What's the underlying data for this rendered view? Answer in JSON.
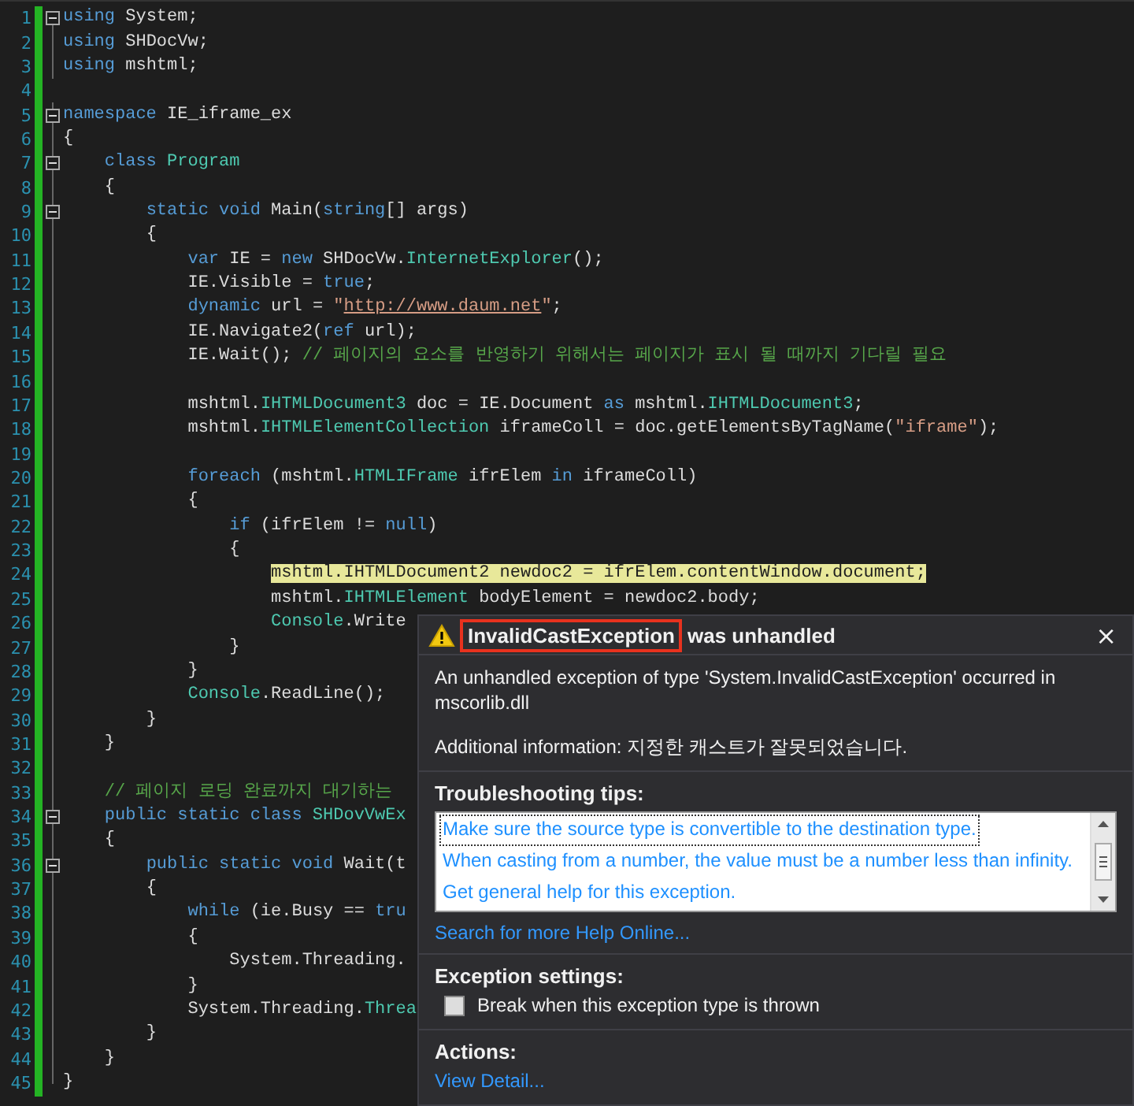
{
  "editor": {
    "lines": [
      {
        "number": "1",
        "fold": true,
        "highlighted": false,
        "tokens": [
          {
            "kind": "keyword",
            "text": "using"
          },
          {
            "kind": "plain",
            "text": " System;"
          }
        ]
      },
      {
        "number": "2",
        "fold": false,
        "highlighted": false,
        "tokens": [
          {
            "kind": "keyword",
            "text": "using"
          },
          {
            "kind": "plain",
            "text": " SHDocVw;"
          }
        ]
      },
      {
        "number": "3",
        "fold": false,
        "highlighted": false,
        "tokens": [
          {
            "kind": "keyword",
            "text": "using"
          },
          {
            "kind": "plain",
            "text": " mshtml;"
          }
        ]
      },
      {
        "number": "4",
        "fold": false,
        "highlighted": false
      },
      {
        "number": "5",
        "fold": true,
        "highlighted": false,
        "tokens": [
          {
            "kind": "keyword",
            "text": "namespace"
          },
          {
            "kind": "plain",
            "text": " IE_iframe_ex"
          }
        ]
      },
      {
        "number": "6",
        "fold": false,
        "highlighted": false,
        "tokens": [
          {
            "kind": "plain",
            "text": "{"
          }
        ]
      },
      {
        "number": "7",
        "fold": true,
        "highlighted": false,
        "tokens": [
          {
            "kind": "keyword",
            "text": "    class"
          },
          {
            "kind": "type",
            "text": " Program"
          }
        ]
      },
      {
        "number": "8",
        "fold": false,
        "highlighted": false,
        "tokens": [
          {
            "kind": "plain",
            "text": "    {"
          }
        ]
      },
      {
        "number": "9",
        "fold": true,
        "highlighted": false,
        "tokens": [
          {
            "kind": "keyword",
            "text": "        static"
          },
          {
            "kind": "keyword",
            "text": " void"
          },
          {
            "kind": "plain",
            "text": " Main("
          },
          {
            "kind": "keyword",
            "text": "string"
          },
          {
            "kind": "plain",
            "text": "[] args)"
          }
        ]
      },
      {
        "number": "10",
        "fold": false,
        "highlighted": false,
        "tokens": [
          {
            "kind": "plain",
            "text": "        {"
          }
        ]
      },
      {
        "number": "11",
        "fold": false,
        "highlighted": false,
        "tokens": [
          {
            "kind": "keyword",
            "text": "            var"
          },
          {
            "kind": "plain",
            "text": " IE = "
          },
          {
            "kind": "keyword",
            "text": "new"
          },
          {
            "kind": "plain",
            "text": " SHDocVw."
          },
          {
            "kind": "type",
            "text": "InternetExplorer"
          },
          {
            "kind": "plain",
            "text": "();"
          }
        ]
      },
      {
        "number": "12",
        "fold": false,
        "highlighted": false,
        "tokens": [
          {
            "kind": "plain",
            "text": "            IE.Visible = "
          },
          {
            "kind": "keyword",
            "text": "true"
          },
          {
            "kind": "plain",
            "text": ";"
          }
        ]
      },
      {
        "number": "13",
        "fold": false,
        "highlighted": false,
        "tokens": [
          {
            "kind": "keyword",
            "text": "            dynamic"
          },
          {
            "kind": "plain",
            "text": " url = "
          },
          {
            "kind": "string",
            "text": "\""
          },
          {
            "kind": "url",
            "text": "http://www.daum.net"
          },
          {
            "kind": "string",
            "text": "\""
          },
          {
            "kind": "plain",
            "text": ";"
          }
        ]
      },
      {
        "number": "14",
        "fold": false,
        "highlighted": false,
        "tokens": [
          {
            "kind": "plain",
            "text": "            IE.Navigate2("
          },
          {
            "kind": "keyword",
            "text": "ref"
          },
          {
            "kind": "plain",
            "text": " url);"
          }
        ]
      },
      {
        "number": "15",
        "fold": false,
        "highlighted": false,
        "tokens": [
          {
            "kind": "plain",
            "text": "            IE.Wait(); "
          },
          {
            "kind": "comment",
            "text": "// 페이지의 요소를 반영하기 위해서는 페이지가 표시 될 때까지 기다릴 필요"
          }
        ]
      },
      {
        "number": "16",
        "fold": false,
        "highlighted": false
      },
      {
        "number": "17",
        "fold": false,
        "highlighted": false,
        "tokens": [
          {
            "kind": "plain",
            "text": "            mshtml."
          },
          {
            "kind": "type",
            "text": "IHTMLDocument3"
          },
          {
            "kind": "plain",
            "text": " doc = IE.Document "
          },
          {
            "kind": "keyword",
            "text": "as"
          },
          {
            "kind": "plain",
            "text": " mshtml."
          },
          {
            "kind": "type",
            "text": "IHTMLDocument3"
          },
          {
            "kind": "plain",
            "text": ";"
          }
        ]
      },
      {
        "number": "18",
        "fold": false,
        "highlighted": false,
        "tokens": [
          {
            "kind": "plain",
            "text": "            mshtml."
          },
          {
            "kind": "type",
            "text": "IHTMLElementCollection"
          },
          {
            "kind": "plain",
            "text": " iframeColl = doc.getElementsByTagName("
          },
          {
            "kind": "string",
            "text": "\"iframe\""
          },
          {
            "kind": "plain",
            "text": ");"
          }
        ]
      },
      {
        "number": "19",
        "fold": false,
        "highlighted": false
      },
      {
        "number": "20",
        "fold": false,
        "highlighted": false,
        "tokens": [
          {
            "kind": "keyword",
            "text": "            foreach"
          },
          {
            "kind": "plain",
            "text": " (mshtml."
          },
          {
            "kind": "type",
            "text": "HTMLIFrame"
          },
          {
            "kind": "plain",
            "text": " ifrElem "
          },
          {
            "kind": "keyword",
            "text": "in"
          },
          {
            "kind": "plain",
            "text": " iframeColl)"
          }
        ]
      },
      {
        "number": "21",
        "fold": false,
        "highlighted": false,
        "tokens": [
          {
            "kind": "plain",
            "text": "            {"
          }
        ]
      },
      {
        "number": "22",
        "fold": false,
        "highlighted": false,
        "tokens": [
          {
            "kind": "keyword",
            "text": "                if"
          },
          {
            "kind": "plain",
            "text": " (ifrElem != "
          },
          {
            "kind": "keyword",
            "text": "null"
          },
          {
            "kind": "plain",
            "text": ")"
          }
        ]
      },
      {
        "number": "23",
        "fold": false,
        "highlighted": false,
        "tokens": [
          {
            "kind": "plain",
            "text": "                {"
          }
        ]
      },
      {
        "number": "24",
        "fold": false,
        "highlighted": true,
        "tokens": [
          {
            "kind": "plain",
            "text": "                    mshtml."
          },
          {
            "kind": "type",
            "text": "IHTMLDocument2"
          },
          {
            "kind": "plain",
            "text": " newdoc2 = ifrElem.contentWindow.document;"
          }
        ]
      },
      {
        "number": "25",
        "fold": false,
        "highlighted": false,
        "tokens": [
          {
            "kind": "plain",
            "text": "                    mshtml."
          },
          {
            "kind": "type",
            "text": "IHTMLElement"
          },
          {
            "kind": "plain",
            "text": " bodyElement = newdoc2.body;"
          }
        ]
      },
      {
        "number": "26",
        "fold": false,
        "highlighted": false,
        "tokens": [
          {
            "kind": "type",
            "text": "                    Console"
          },
          {
            "kind": "plain",
            "text": ".Write"
          }
        ]
      },
      {
        "number": "27",
        "fold": false,
        "highlighted": false,
        "tokens": [
          {
            "kind": "plain",
            "text": "                }"
          }
        ]
      },
      {
        "number": "28",
        "fold": false,
        "highlighted": false,
        "tokens": [
          {
            "kind": "plain",
            "text": "            }"
          }
        ]
      },
      {
        "number": "29",
        "fold": false,
        "highlighted": false,
        "tokens": [
          {
            "kind": "type",
            "text": "            Console"
          },
          {
            "kind": "plain",
            "text": ".ReadLine();"
          }
        ]
      },
      {
        "number": "30",
        "fold": false,
        "highlighted": false,
        "tokens": [
          {
            "kind": "plain",
            "text": "        }"
          }
        ]
      },
      {
        "number": "31",
        "fold": false,
        "highlighted": false,
        "tokens": [
          {
            "kind": "plain",
            "text": "    }"
          }
        ]
      },
      {
        "number": "32",
        "fold": false,
        "highlighted": false
      },
      {
        "number": "33",
        "fold": false,
        "highlighted": false,
        "tokens": [
          {
            "kind": "comment",
            "text": "    // 페이지 로딩 완료까지 대기하는"
          }
        ]
      },
      {
        "number": "34",
        "fold": true,
        "highlighted": false,
        "tokens": [
          {
            "kind": "keyword",
            "text": "    public static class"
          },
          {
            "kind": "type",
            "text": " SHDovVwEx"
          }
        ]
      },
      {
        "number": "35",
        "fold": false,
        "highlighted": false,
        "tokens": [
          {
            "kind": "plain",
            "text": "    {"
          }
        ]
      },
      {
        "number": "36",
        "fold": true,
        "highlighted": false,
        "tokens": [
          {
            "kind": "keyword",
            "text": "        public static void"
          },
          {
            "kind": "plain",
            "text": " Wait(t"
          }
        ]
      },
      {
        "number": "37",
        "fold": false,
        "highlighted": false,
        "tokens": [
          {
            "kind": "plain",
            "text": "        {"
          }
        ]
      },
      {
        "number": "38",
        "fold": false,
        "highlighted": false,
        "tokens": [
          {
            "kind": "keyword",
            "text": "            while"
          },
          {
            "kind": "plain",
            "text": " (ie.Busy == "
          },
          {
            "kind": "keyword",
            "text": "tru"
          }
        ]
      },
      {
        "number": "39",
        "fold": false,
        "highlighted": false,
        "tokens": [
          {
            "kind": "plain",
            "text": "            {"
          }
        ]
      },
      {
        "number": "40",
        "fold": false,
        "highlighted": false,
        "tokens": [
          {
            "kind": "plain",
            "text": "                System.Threading."
          }
        ]
      },
      {
        "number": "41",
        "fold": false,
        "highlighted": false,
        "tokens": [
          {
            "kind": "plain",
            "text": "            }"
          }
        ]
      },
      {
        "number": "42",
        "fold": false,
        "highlighted": false,
        "tokens": [
          {
            "kind": "plain",
            "text": "            System.Threading."
          },
          {
            "kind": "type",
            "text": "Threa"
          }
        ]
      },
      {
        "number": "43",
        "fold": false,
        "highlighted": false,
        "tokens": [
          {
            "kind": "plain",
            "text": "        }"
          }
        ]
      },
      {
        "number": "44",
        "fold": false,
        "highlighted": false,
        "tokens": [
          {
            "kind": "plain",
            "text": "    }"
          }
        ]
      },
      {
        "number": "45",
        "fold": false,
        "highlighted": false,
        "tokens": [
          {
            "kind": "plain",
            "text": "}"
          }
        ]
      }
    ]
  },
  "exception_dialog": {
    "exception_name": "InvalidCastException",
    "title_rest": "was unhandled",
    "close": "×",
    "message": "An unhandled exception of type 'System.InvalidCastException' occurred in mscorlib.dll",
    "additional_info": "Additional information: 지정한 캐스트가 잘못되었습니다.",
    "tips_heading": "Troubleshooting tips:",
    "tips": [
      {
        "text": "Make sure the source type is convertible to the destination type.",
        "selected": true
      },
      {
        "text": "When casting from a number, the value must be a number less than infinity.",
        "selected": false
      },
      {
        "text": "Get general help for this exception.",
        "selected": false
      }
    ],
    "search_link": "Search for more Help Online...",
    "settings_heading": "Exception settings:",
    "break_option": {
      "label": "Break when this exception type is thrown",
      "checked": false
    },
    "actions_heading": "Actions:",
    "actions": [
      "View Detail..."
    ]
  }
}
